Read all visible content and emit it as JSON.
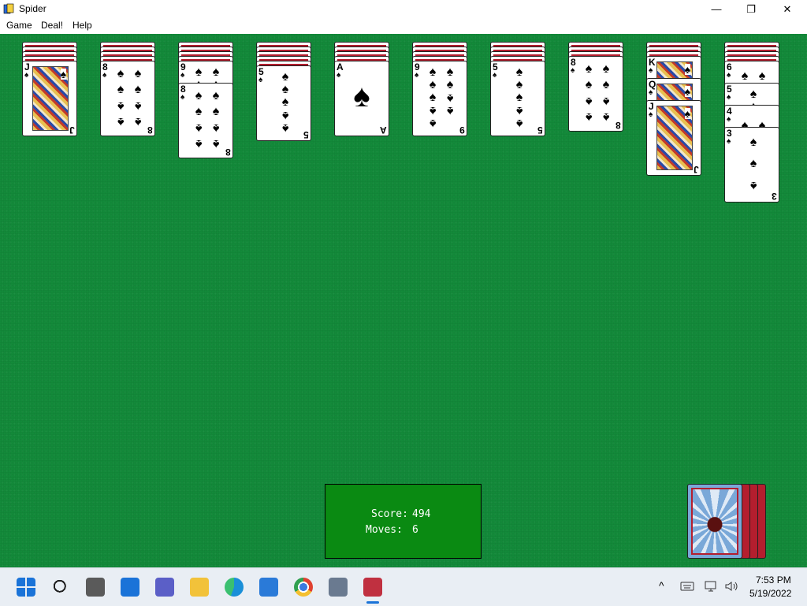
{
  "window": {
    "title": "Spider",
    "minimize_glyph": "—",
    "restore_glyph": "❐",
    "close_glyph": "✕"
  },
  "menu": {
    "items": [
      "Game",
      "Deal!",
      "Help"
    ]
  },
  "colors": {
    "felt": "#138a3a",
    "card_back": "#b41e2e",
    "score_box": "#0a8a12"
  },
  "tableau": [
    {
      "hidden": 4,
      "cards": [
        {
          "rank": "J",
          "suit": "♠"
        }
      ]
    },
    {
      "hidden": 4,
      "cards": [
        {
          "rank": "8",
          "suit": "♠"
        }
      ]
    },
    {
      "hidden": 4,
      "cards": [
        {
          "rank": "9",
          "suit": "♠"
        },
        {
          "rank": "8",
          "suit": "♠"
        }
      ]
    },
    {
      "hidden": 5,
      "cards": [
        {
          "rank": "5",
          "suit": "♠"
        }
      ]
    },
    {
      "hidden": 4,
      "cards": [
        {
          "rank": "A",
          "suit": "♠"
        }
      ]
    },
    {
      "hidden": 4,
      "cards": [
        {
          "rank": "9",
          "suit": "♠"
        }
      ]
    },
    {
      "hidden": 4,
      "cards": [
        {
          "rank": "5",
          "suit": "♠"
        }
      ]
    },
    {
      "hidden": 3,
      "cards": [
        {
          "rank": "8",
          "suit": "♠"
        }
      ]
    },
    {
      "hidden": 3,
      "cards": [
        {
          "rank": "K",
          "suit": "♠"
        },
        {
          "rank": "Q",
          "suit": "♠"
        },
        {
          "rank": "J",
          "suit": "♠"
        }
      ]
    },
    {
      "hidden": 4,
      "cards": [
        {
          "rank": "6",
          "suit": "♠"
        },
        {
          "rank": "5",
          "suit": "♠"
        },
        {
          "rank": "4",
          "suit": "♠"
        },
        {
          "rank": "3",
          "suit": "♠"
        }
      ]
    }
  ],
  "score_panel": {
    "score_label": "Score:",
    "score": "494",
    "moves_label": "Moves:",
    "moves": "6"
  },
  "stock": {
    "remaining_deals": 4
  },
  "taskbar": {
    "icons": [
      "start-icon",
      "search-icon",
      "task-view-icon",
      "widgets-icon",
      "chat-icon",
      "file-explorer-icon",
      "edge-icon",
      "store-icon",
      "chrome-icon",
      "settings-icon",
      "spider-solitaire-icon"
    ],
    "tray_chevron": "^",
    "time": "7:53 PM",
    "date": "5/19/2022"
  }
}
